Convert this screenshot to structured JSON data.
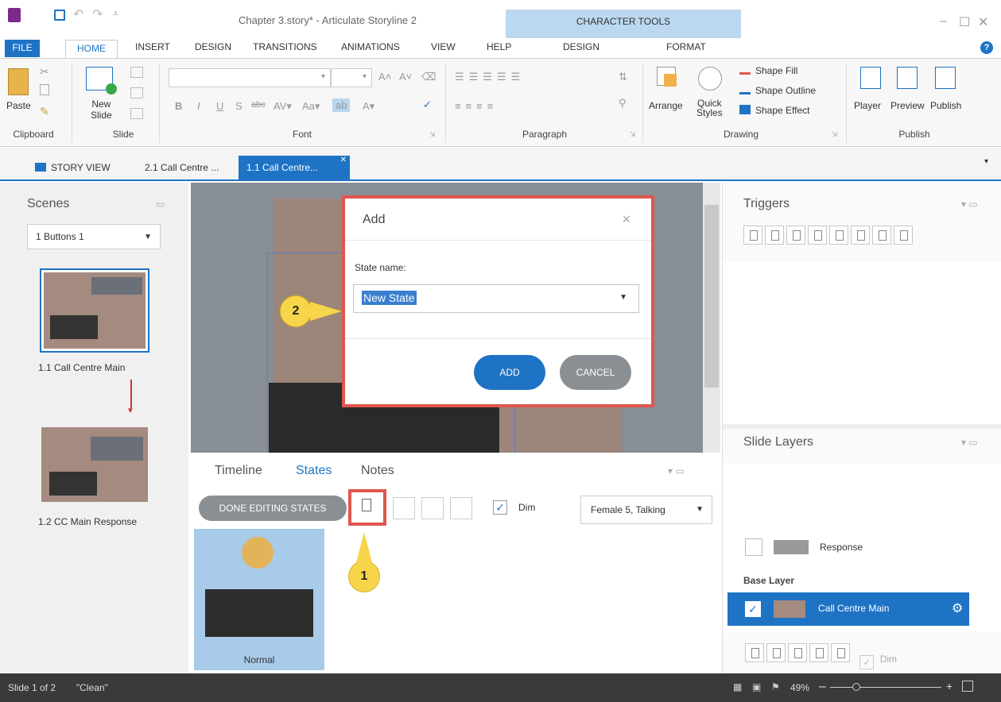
{
  "app": {
    "title": "Chapter 3.story* - Articulate Storyline 2",
    "context_tab_group": "CHARACTER TOOLS"
  },
  "ribbon_tabs": [
    "FILE",
    "HOME",
    "INSERT",
    "DESIGN",
    "TRANSITIONS",
    "ANIMATIONS",
    "VIEW",
    "HELP",
    "DESIGN",
    "FORMAT"
  ],
  "ribbon": {
    "clipboard": {
      "paste": "Paste",
      "label": "Clipboard"
    },
    "slide": {
      "new_slide_1": "New",
      "new_slide_2": "Slide",
      "label": "Slide"
    },
    "font": {
      "label": "Font"
    },
    "paragraph": {
      "label": "Paragraph"
    },
    "drawing": {
      "arrange": "Arrange",
      "quick_1": "Quick",
      "quick_2": "Styles",
      "shape_fill": "Shape Fill",
      "shape_outline": "Shape Outline",
      "shape_effect": "Shape Effect",
      "label": "Drawing"
    },
    "publish": {
      "player": "Player",
      "preview": "Preview",
      "publish": "Publish",
      "label": "Publish"
    }
  },
  "doc_tabs": {
    "story_view": "STORY VIEW",
    "tab1": "2.1 Call Centre ...",
    "tab2": "1.1 Call Centre..."
  },
  "scenes": {
    "title": "Scenes",
    "dropdown": "1 Buttons 1",
    "slides": [
      {
        "label": "1.1 Call Centre Main"
      },
      {
        "label": "1.2 CC Main Response"
      }
    ]
  },
  "dialog": {
    "title": "Add",
    "field_label": "State name:",
    "field_value": "New State",
    "add": "ADD",
    "cancel": "CANCEL"
  },
  "callouts": {
    "one": "1",
    "two": "2"
  },
  "bottom_tabs": {
    "timeline": "Timeline",
    "states": "States",
    "notes": "Notes"
  },
  "states": {
    "done_button": "DONE EDITING STATES",
    "dim": "Dim",
    "character_select": "Female 5, Talking",
    "normal_label": "Normal"
  },
  "triggers": {
    "title": "Triggers"
  },
  "layers": {
    "title": "Slide Layers",
    "response": "Response",
    "base_layer": "Base Layer",
    "call_centre_main": "Call Centre Main",
    "dim": "Dim"
  },
  "status": {
    "slide": "Slide 1 of 2",
    "theme": "\"Clean\"",
    "zoom": "49%"
  },
  "colors": {
    "accent": "#1e73c4",
    "highlight_box": "#e0564f",
    "callout": "#f7d54a"
  }
}
